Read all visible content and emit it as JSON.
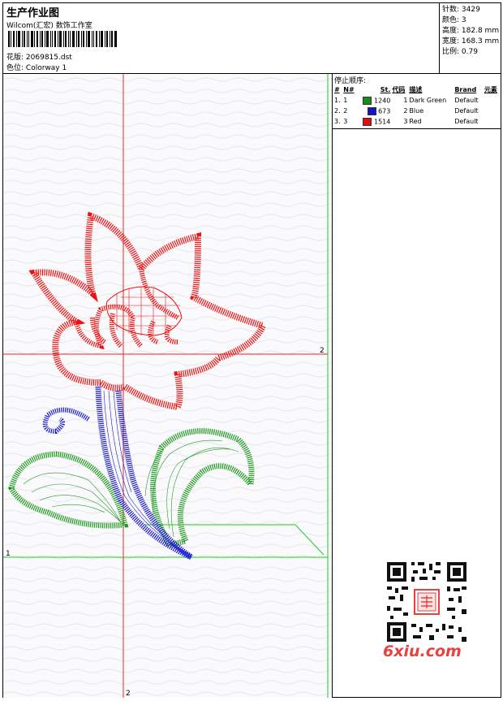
{
  "header": {
    "title": "生产作业图",
    "subtitle": "Wilcom(汇宏) 数饰工作室",
    "design": {
      "label": "花版:",
      "value": "2069815.dst"
    },
    "colorway": {
      "label": "色位:",
      "value": "Colorway 1"
    }
  },
  "stats": [
    {
      "label": "针数",
      "value": "3429"
    },
    {
      "label": "颜色",
      "value": "3"
    },
    {
      "label": "高度",
      "value": "182.8 mm"
    },
    {
      "label": "宽度",
      "value": "168.3 mm"
    },
    {
      "label": "比例",
      "value": "0.79"
    }
  ],
  "stop_sequence": {
    "label": "停止顺序:",
    "columns": [
      "#",
      "N#",
      "St.",
      "代码",
      "描述",
      "Brand",
      "元素"
    ],
    "rows": [
      {
        "num": "1.",
        "n": "1",
        "color": "#1a8a1a",
        "stitches": "1240",
        "code": "1",
        "desc": "Dark Green",
        "brand": "Default"
      },
      {
        "num": "2.",
        "n": "2",
        "color": "#1414c8",
        "stitches": "673",
        "code": "2",
        "desc": "Blue",
        "brand": "Default"
      },
      {
        "num": "3.",
        "n": "3",
        "color": "#e01010",
        "stitches": "1514",
        "code": "3",
        "desc": "Red",
        "brand": "Default"
      }
    ]
  },
  "guides": {
    "h_label_right": "2",
    "h_label_left": "1",
    "v_label_bottom": "2"
  },
  "watermark": {
    "text": "6xiu.com",
    "seal": "双图 6图"
  },
  "colors": {
    "red": "#ee1111",
    "green": "#1f9a1f",
    "blue": "#1a1ad0",
    "guide_green": "#22cc22",
    "guide_red": "#ee2222"
  }
}
